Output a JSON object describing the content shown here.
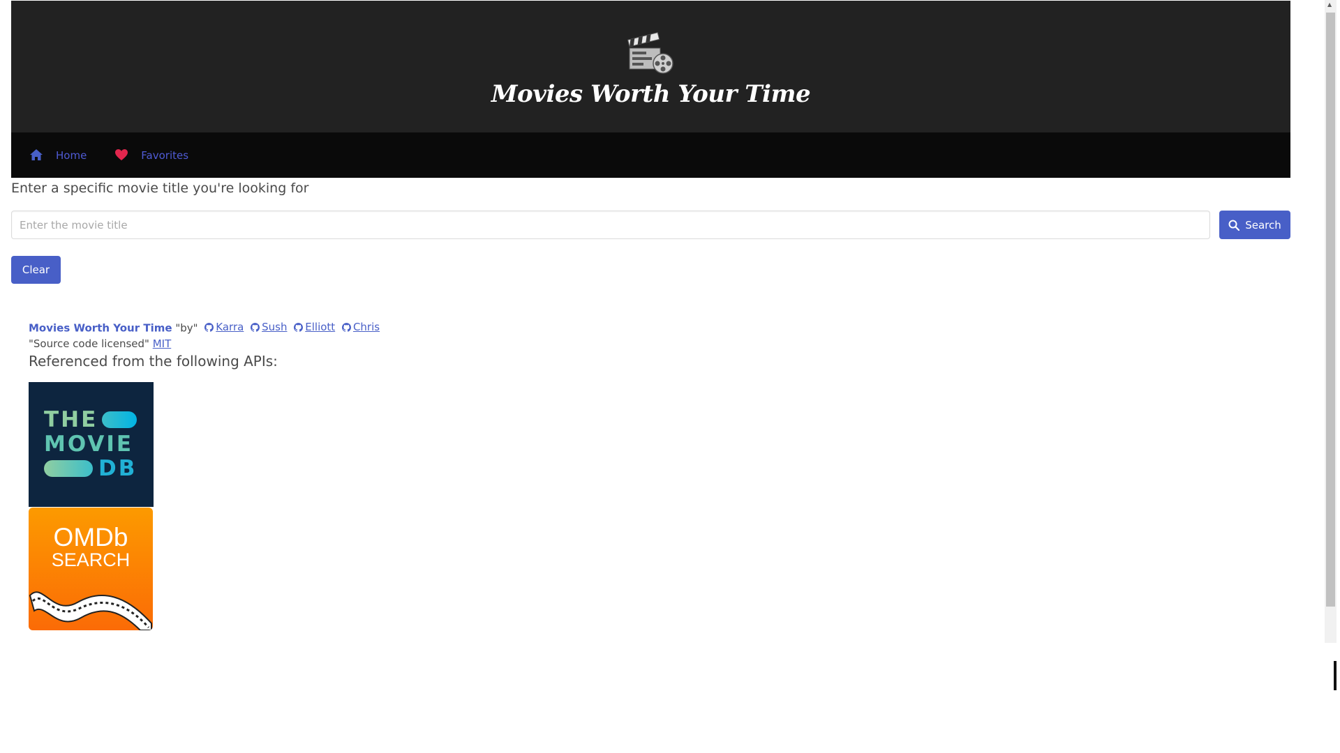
{
  "header": {
    "logo_icon": "clapperboard-film-reel-icon",
    "title": "Movies Worth Your Time"
  },
  "nav": {
    "items": [
      {
        "label": "Home",
        "icon": "home-icon",
        "color": "#485fc7"
      },
      {
        "label": "Favorites",
        "icon": "heart-icon",
        "color": "#f14668"
      }
    ]
  },
  "search": {
    "prompt": "Enter a specific movie title you're looking for",
    "placeholder": "Enter the movie title",
    "value": "",
    "button_label": "Search",
    "clear_label": "Clear"
  },
  "footer": {
    "brand": "Movies Worth Your Time",
    "by": "\"by\"",
    "authors": [
      "Karra",
      "Sush",
      "Elliott",
      "Chris"
    ],
    "license_text": "\"Source code licensed\"",
    "license_link": "MIT",
    "apis_label": "Referenced from the following APIs:",
    "tmdb_logo": {
      "line1": "THE",
      "line2": "MOVIE",
      "line3": "DB"
    },
    "omdb_logo": {
      "title": "OMDb",
      "subtitle": "SEARCH"
    }
  },
  "colors": {
    "accent": "#485fc7",
    "hero_bg": "#222222",
    "nav_bg": "#0a0a0a"
  }
}
